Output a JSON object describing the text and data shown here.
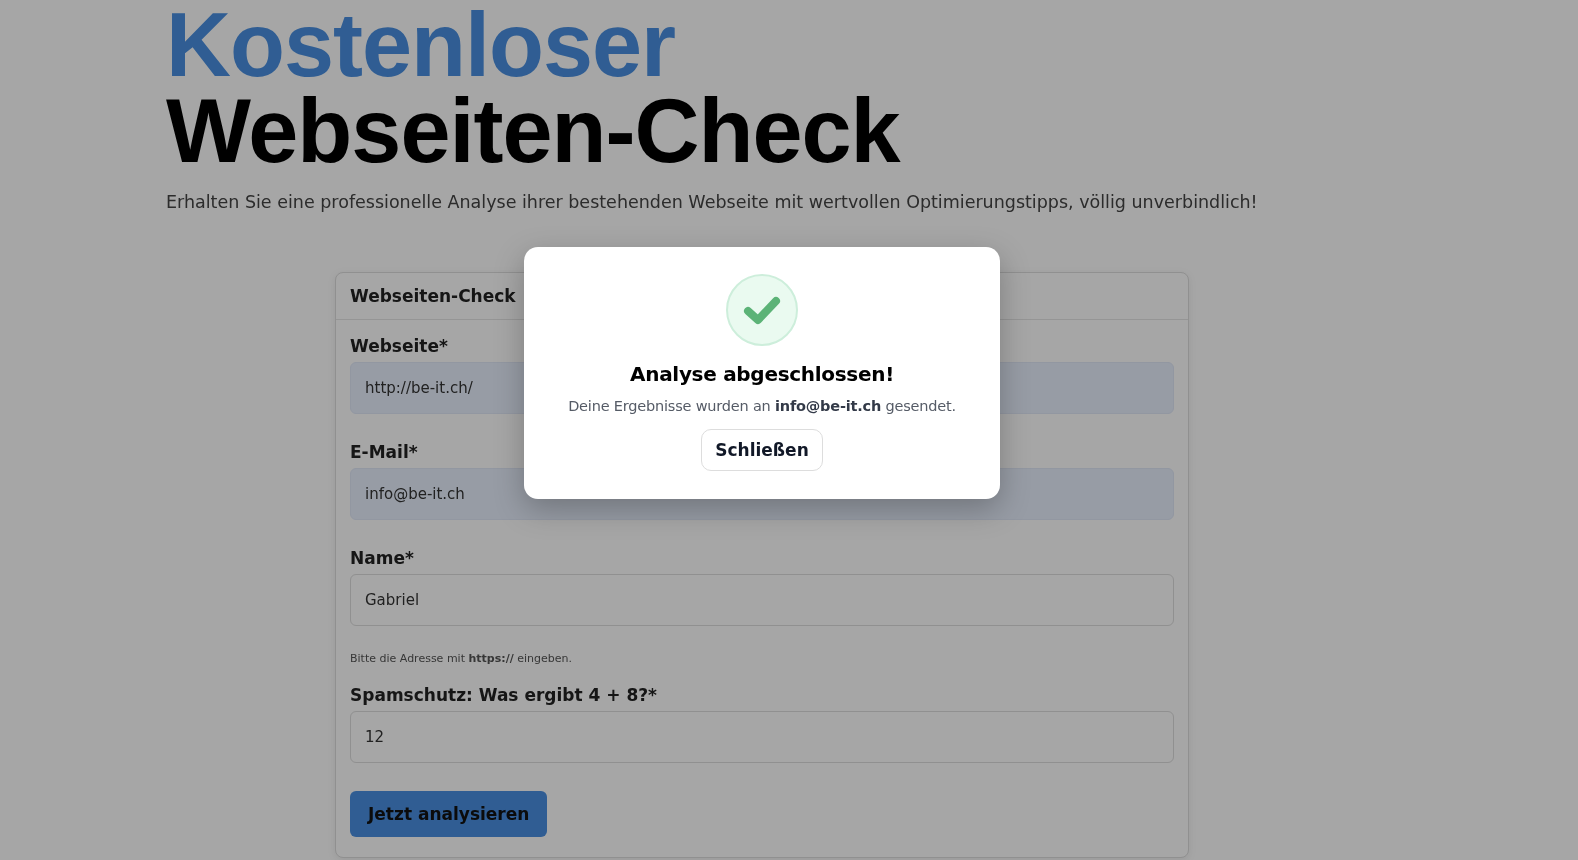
{
  "hero": {
    "title_line_1": "Kostenloser",
    "title_line_2": "Webseiten-Check",
    "subtitle": "Erhalten Sie eine professionelle Analyse ihrer bestehenden Webseite mit wertvollen Optimierungstipps, völlig unverbindlich!"
  },
  "form": {
    "title": "Webseiten-Check",
    "fields": [
      {
        "label": "Webseite*",
        "value": "http://be-it.ch/",
        "autofilled": true
      },
      {
        "label": "E-Mail*",
        "value": "info@be-it.ch",
        "autofilled": true
      },
      {
        "label": "Name*",
        "value": "Gabriel",
        "autofilled": false
      }
    ],
    "hint": "Bitte die Adresse mit **https://** eingeben.",
    "captcha": {
      "label": "Spamschutz: Was ergibt 4 + 8?*",
      "value": "12",
      "autofilled": false
    },
    "submit": "Jetzt analysieren"
  },
  "dialog": {
    "title": "Analyse abgeschlossen!",
    "message": "Deine Ergebnisse wurden an **info@be-it.ch** gesendet.",
    "button": "Schließen"
  }
}
